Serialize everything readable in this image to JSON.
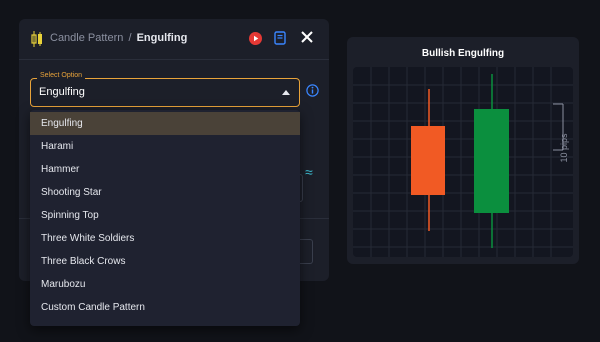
{
  "header": {
    "section": "Candle Pattern",
    "separator": "/",
    "current": "Engulfing"
  },
  "select": {
    "label": "Select Option",
    "value": "Engulfing"
  },
  "dropdown": {
    "options": [
      "Engulfing",
      "Harami",
      "Hammer",
      "Shooting Star",
      "Spinning Top",
      "Three White Soldiers",
      "Three Black Crows",
      "Marubozu",
      "Custom Candle Pattern"
    ],
    "selected_index": 0
  },
  "preview": {
    "title": "Bullish Engulfing",
    "pips_label": "10 pips"
  },
  "colors": {
    "accent": "#e8a33a",
    "bearish": "#f15a24",
    "bullish": "#0b8f3e",
    "play": "#e53935",
    "book": "#3a86ff",
    "info": "#3a86ff"
  },
  "icons": {
    "header": "candlestick-icon",
    "play": "play-icon",
    "book": "book-icon",
    "close": "close-icon",
    "info": "info-icon",
    "approx": "approx-wave-icon"
  }
}
